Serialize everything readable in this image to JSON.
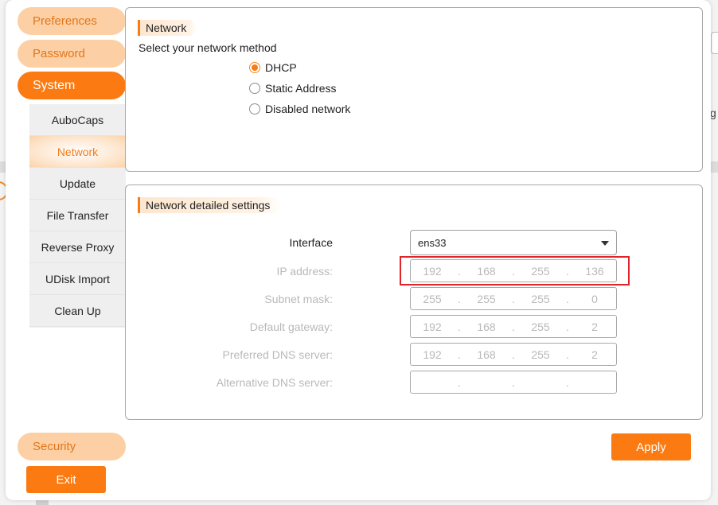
{
  "nav": {
    "preferences": "Preferences",
    "password": "Password",
    "system": "System",
    "security": "Security",
    "exit": "Exit"
  },
  "subnav": [
    "AuboCaps",
    "Network",
    "Update",
    "File Transfer",
    "Reverse Proxy",
    "UDisk Import",
    "Clean Up"
  ],
  "subnav_active": "Network",
  "network": {
    "title": "Network",
    "method_label": "Select your network method",
    "options": [
      "DHCP",
      "Static Address",
      "Disabled network"
    ],
    "selected": "DHCP"
  },
  "details": {
    "title": "Network detailed settings",
    "interface_label": "Interface",
    "interface_value": "ens33",
    "ip_label": "IP address:",
    "ip": [
      "192",
      "168",
      "255",
      "136"
    ],
    "subnet_label": "Subnet mask:",
    "subnet": [
      "255",
      "255",
      "255",
      "0"
    ],
    "gateway_label": "Default gateway:",
    "gateway": [
      "192",
      "168",
      "255",
      "2"
    ],
    "dns1_label": "Preferred DNS server:",
    "dns1": [
      "192",
      "168",
      "255",
      "2"
    ],
    "dns2_label": "Alternative DNS server:",
    "dns2": [
      "",
      "",
      "",
      ""
    ]
  },
  "apply": "Apply",
  "background": {
    "partial_letter": "g"
  },
  "colors": {
    "accent": "#fb7b12",
    "accent_light": "#fcd0a4",
    "highlight": "#e0252a"
  }
}
